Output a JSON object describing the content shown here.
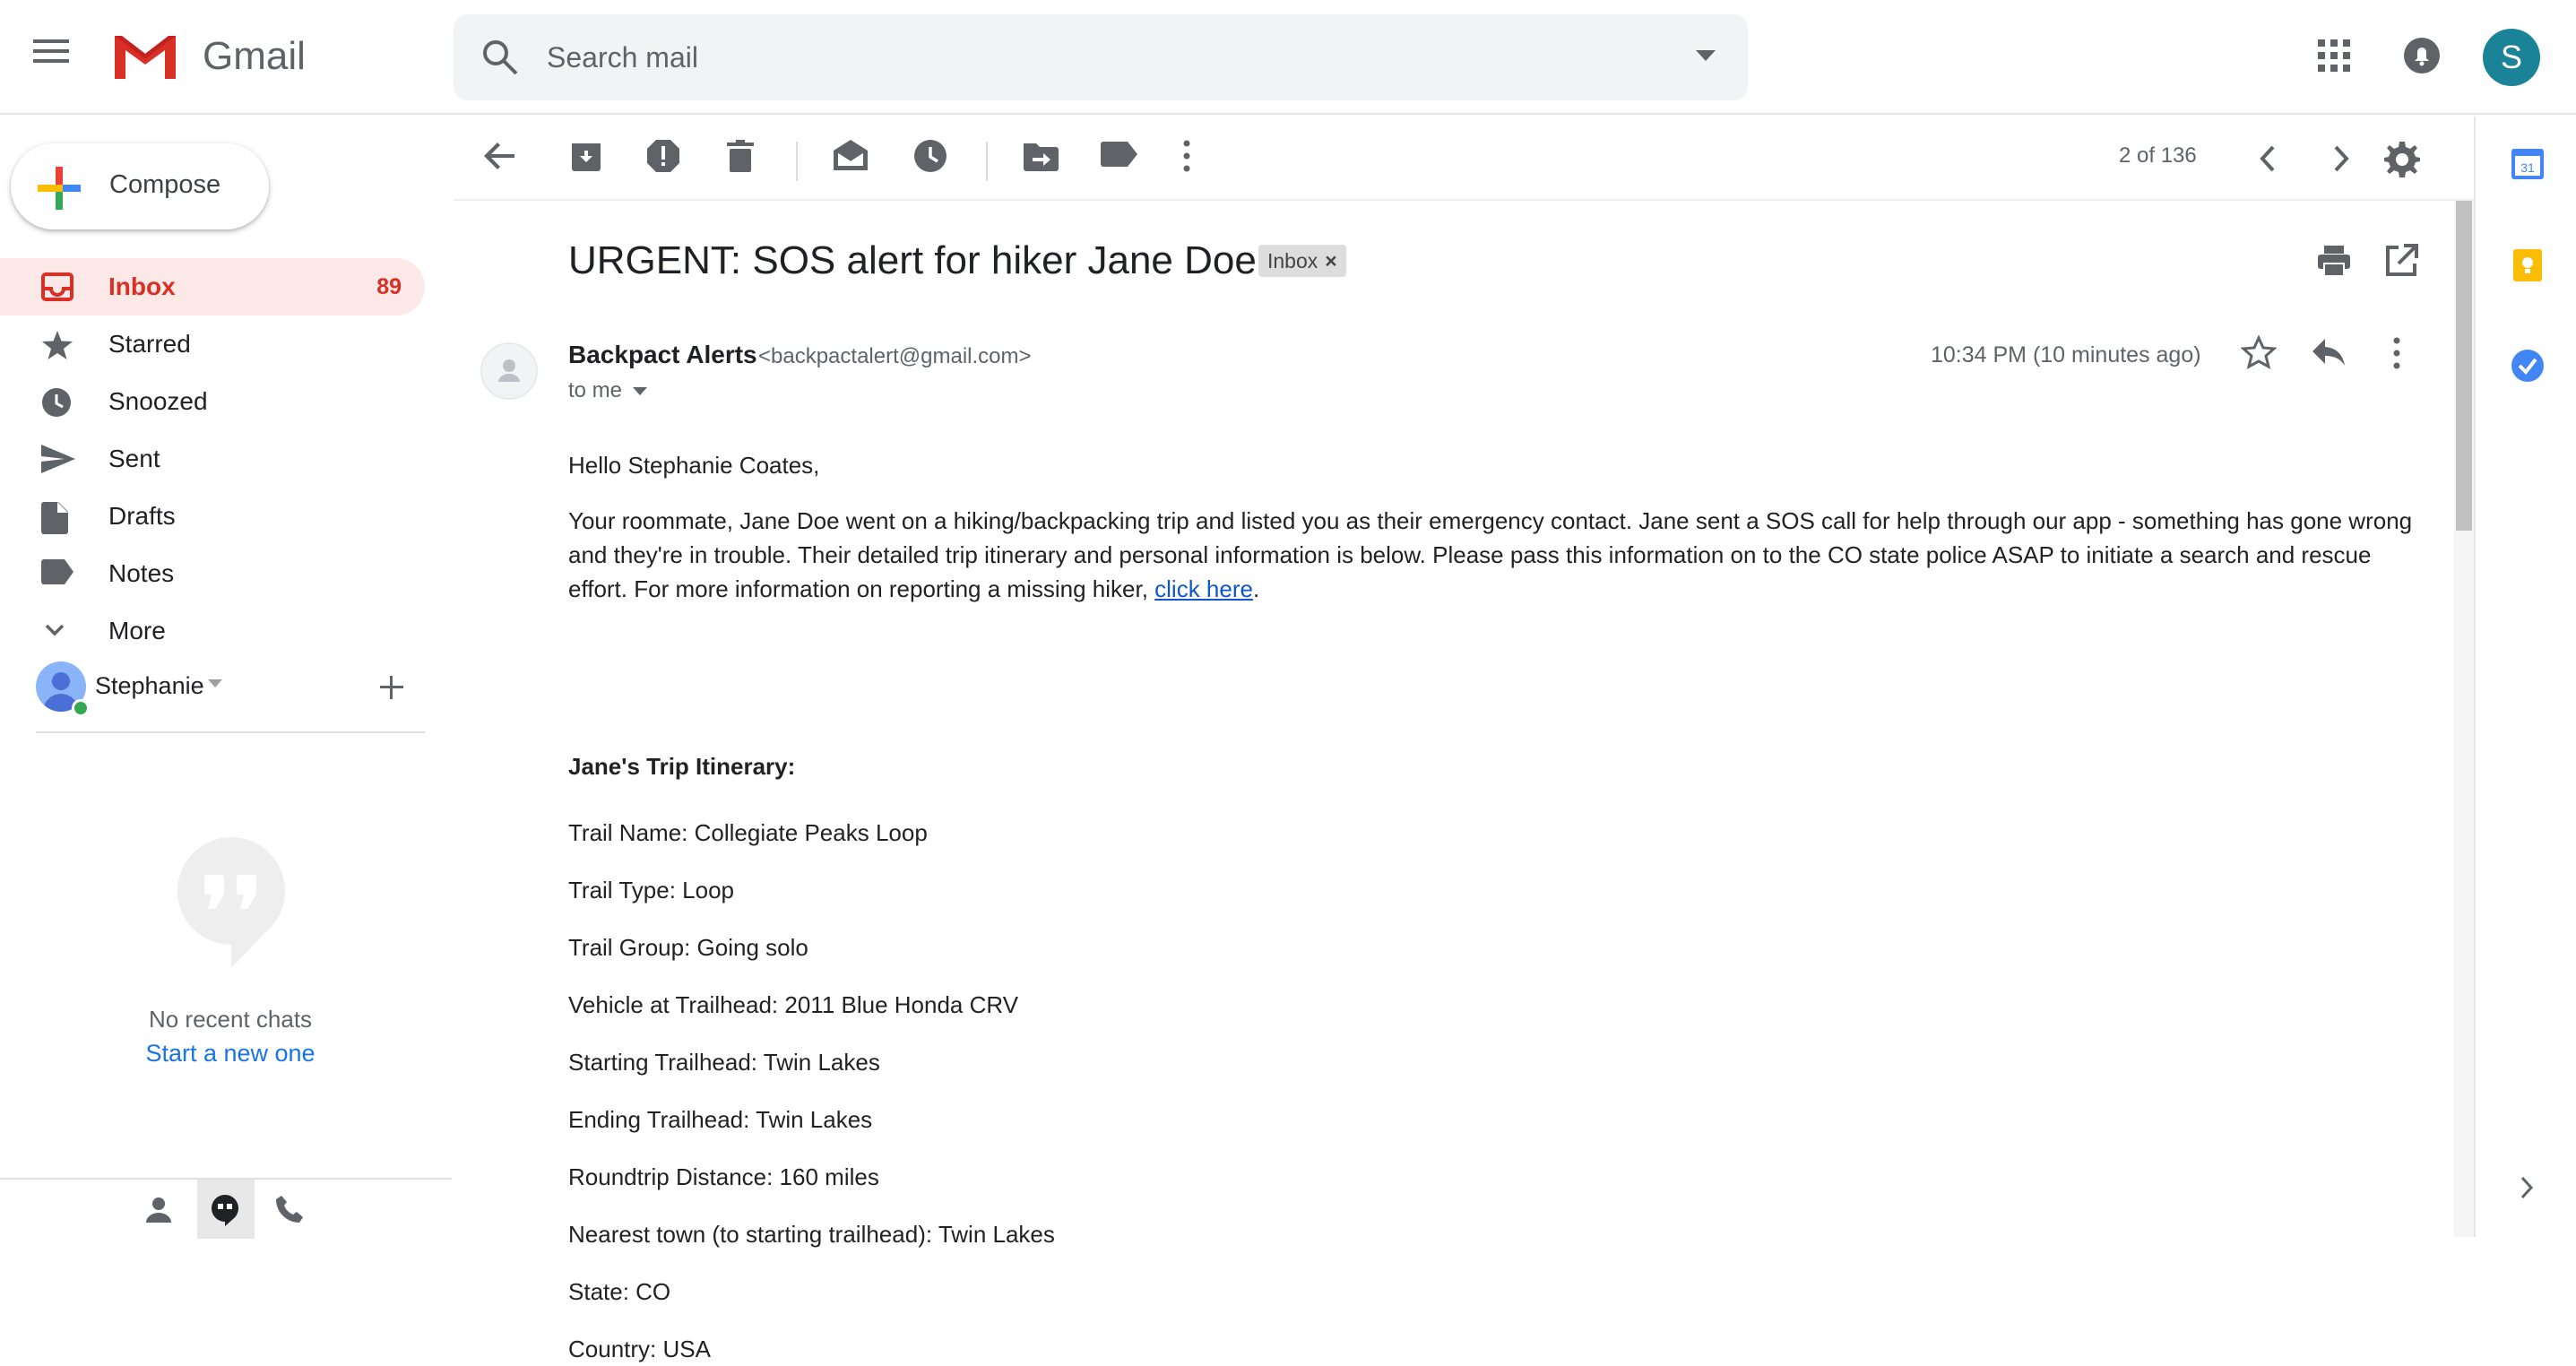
{
  "header": {
    "app_name": "Gmail",
    "search_placeholder": "Search mail",
    "avatar_letter": "S"
  },
  "compose": {
    "label": "Compose"
  },
  "nav": {
    "items": [
      {
        "label": "Inbox",
        "count": "89",
        "icon": "inbox-icon"
      },
      {
        "label": "Starred",
        "count": "",
        "icon": "star-icon"
      },
      {
        "label": "Snoozed",
        "count": "",
        "icon": "clock-icon"
      },
      {
        "label": "Sent",
        "count": "",
        "icon": "send-icon"
      },
      {
        "label": "Drafts",
        "count": "",
        "icon": "draft-icon"
      },
      {
        "label": "Notes",
        "count": "",
        "icon": "label-icon"
      },
      {
        "label": "More",
        "count": "",
        "icon": "chevron-down-icon"
      }
    ]
  },
  "hangouts": {
    "user_name": "Stephanie",
    "no_chats": "No recent chats",
    "start_new": "Start a new one"
  },
  "toolbar": {
    "pager": "2 of 136"
  },
  "email": {
    "subject": "URGENT: SOS alert for hiker Jane Doe",
    "tag": "Inbox",
    "sender_name": "Backpact Alerts",
    "sender_email": "<backpactalert@gmail.com>",
    "to": "to me",
    "time": "10:34 PM (10 minutes ago)",
    "greeting": "Hello Stephanie Coates,",
    "paragraph": "Your roommate, Jane Doe went on a hiking/backpacking trip and listed you as their emergency contact. Jane sent a SOS call for help through our app - something has gone wrong and they're in trouble. Their detailed trip itinerary and personal information is below. Please pass this information on to the CO state police ASAP to initiate a search and rescue effort. For more information on reporting a missing hiker, ",
    "link_text": "click here",
    "paragraph_end": ".",
    "itinerary_heading": "Jane's Trip Itinerary:",
    "itinerary": [
      "Trail Name: Collegiate Peaks Loop",
      "Trail Type: Loop",
      "Trail Group: Going solo",
      "Vehicle at Trailhead: 2011 Blue Honda CRV",
      "Starting Trailhead: Twin Lakes",
      "Ending Trailhead: Twin Lakes",
      "Roundtrip Distance: 160 miles",
      "Nearest town (to starting trailhead): Twin Lakes",
      "State: CO",
      "Country: USA"
    ]
  }
}
